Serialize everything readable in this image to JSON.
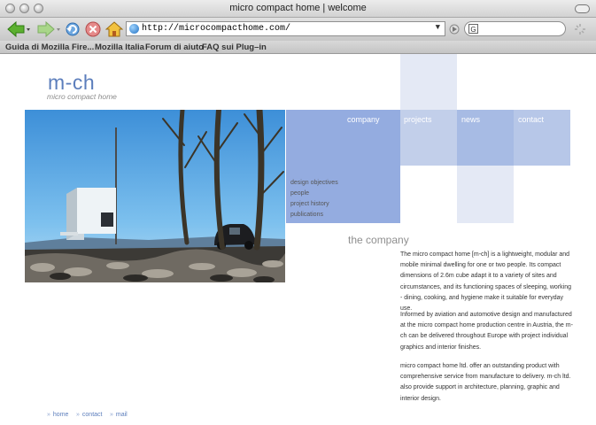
{
  "window": {
    "title": "micro compact home | welcome"
  },
  "toolbar": {
    "url": "http://microcompacthome.com/",
    "search_placeholder": ""
  },
  "bookmarks": [
    "Guida di Mozilla Fire...",
    "Mozilla Italia",
    "Forum di aiuto",
    "FAQ sui Plug–in"
  ],
  "site": {
    "logo": "m-ch",
    "logo_sub": "micro compact home",
    "nav": [
      "company",
      "projects",
      "news",
      "contact"
    ],
    "submenu": [
      "design objectives",
      "people",
      "project history",
      "publications"
    ],
    "section_title": "the company",
    "paragraphs": [
      "The micro compact home [m-ch] is a lightweight, modular and mobile minimal dwelling for one or two people. Its compact dimensions of 2.6m cube adapt it to a variety of sites and circumstances, and its functioning spaces of sleeping, working - dining, cooking, and hygiene make it suitable for everyday use.",
      "Informed by aviation and automotive design and manufactured at the micro compact home production centre in Austria, the m-ch can be delivered throughout Europe with project individual graphics and interior finishes.",
      "micro compact home ltd. offer an outstanding product with comprehensive service from manufacture to delivery. m-ch ltd. also provide support in architecture, planning, graphic and interior design."
    ],
    "footer_links": [
      "home",
      "contact",
      "mail"
    ],
    "colors": {
      "block_dark": "#94ace0",
      "block_mid": "#c2cfea",
      "block_light": "#e4e9f5",
      "logo": "#5c7ebc"
    }
  }
}
